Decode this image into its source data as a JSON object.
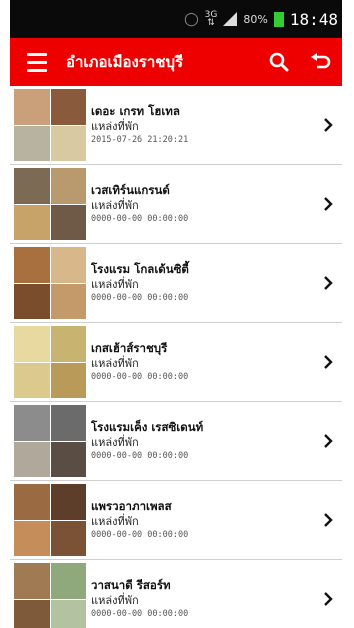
{
  "status_bar": {
    "network_type": "3G",
    "battery_percent": "80%",
    "time": "18:48",
    "battery_color": "#33cc33"
  },
  "app_bar": {
    "title": "อำเภอเมืองราชบุรี",
    "menu_icon": "hamburger-menu-icon",
    "search_icon": "search-icon",
    "back_icon": "back-arrow-icon",
    "color": "#ee0000"
  },
  "items": [
    {
      "name": "เดอะ เกรท โฮเทล",
      "category": "แหล่งที่พัก",
      "date": "2015-07-26 21:20:21",
      "thumb_colors": [
        "#c9a07a",
        "#8a5a3c",
        "#b8b2a0",
        "#d9c9a3"
      ]
    },
    {
      "name": "เวสเทิร์นแกรนด์",
      "category": "แหล่งที่พัก",
      "date": "0000-00-00 00:00:00",
      "thumb_colors": [
        "#7d6a55",
        "#b89a6e",
        "#c7a36a",
        "#6e5a46"
      ]
    },
    {
      "name": "โรงแรม โกลเด้นซิตี้",
      "category": "แหล่งที่พัก",
      "date": "0000-00-00 00:00:00",
      "thumb_colors": [
        "#a9703f",
        "#d8b88a",
        "#7a4d2c",
        "#c49a6a"
      ]
    },
    {
      "name": "เกสเฮ้าส์ราชบุรี",
      "category": "แหล่งที่พัก",
      "date": "0000-00-00 00:00:00",
      "thumb_colors": [
        "#e8d9a0",
        "#c8b370",
        "#dcc98e",
        "#b99a58"
      ]
    },
    {
      "name": "โรงแรมเค็ง เรสซิเดนท์",
      "category": "แหล่งที่พัก",
      "date": "0000-00-00 00:00:00",
      "thumb_colors": [
        "#8c8c8c",
        "#6b6b6b",
        "#b0a89a",
        "#5a4e44"
      ]
    },
    {
      "name": "แพรวอาภาเพลส",
      "category": "แหล่งที่พัก",
      "date": "0000-00-00 00:00:00",
      "thumb_colors": [
        "#9a6a42",
        "#5c3e2a",
        "#c48d5a",
        "#7c5236"
      ]
    },
    {
      "name": "วาสนาดี รีสอร์ท",
      "category": "แหล่งที่พัก",
      "date": "0000-00-00 00:00:00",
      "thumb_colors": [
        "#a07a52",
        "#8fa87c",
        "#7e5a3a",
        "#b3c2a0"
      ]
    }
  ]
}
